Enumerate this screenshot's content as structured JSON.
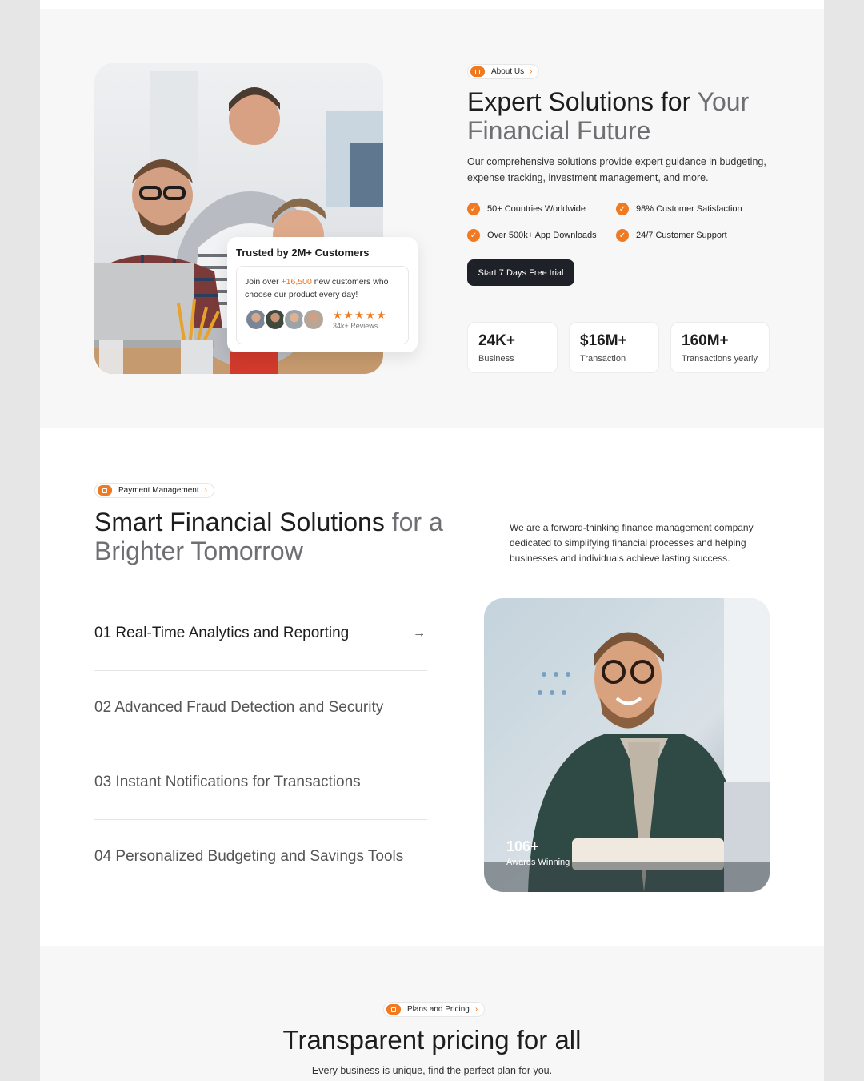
{
  "about": {
    "pill_label": "About Us",
    "heading_main": "Expert Solutions for ",
    "heading_muted": "Your Financial Future",
    "lead": "Our comprehensive solutions provide expert guidance in budgeting, expense tracking, investment management, and more.",
    "features": [
      "50+ Countries Worldwide",
      "98% Customer Satisfaction",
      "Over 500k+ App Downloads",
      "24/7 Customer Support"
    ],
    "cta_label": "Start 7 Days Free trial",
    "stats": [
      {
        "value": "24K+",
        "label": "Business"
      },
      {
        "value": "$16M+",
        "label": "Transaction"
      },
      {
        "value": "160M+",
        "label": "Transactions yearly"
      }
    ]
  },
  "trust": {
    "title": "Trusted by 2M+ Customers",
    "text_before": "Join over ",
    "highlight": "+16,500",
    "text_after": " new customers who choose our product every day!",
    "stars": "★★★★★",
    "reviews": "34k+ Reviews",
    "rating": 5
  },
  "payment": {
    "pill_label": "Payment Management",
    "heading_main": "Smart Financial Solutions ",
    "heading_muted": "for a Brighter Tomorrow",
    "description": "We are a forward-thinking finance management company dedicated to simplifying financial processes and helping businesses and individuals achieve lasting success.",
    "items": [
      "01 Real-Time Analytics and Reporting",
      "02 Advanced Fraud Detection and Security",
      "03 Instant Notifications for Transactions",
      "04 Personalized Budgeting and Savings Tools"
    ],
    "award_value": "106+",
    "award_label": "Awards Winning"
  },
  "pricing": {
    "pill_label": "Plans and Pricing",
    "heading": "Transparent pricing for all",
    "subheading": "Every business is unique, find the perfect plan for you."
  },
  "icons": {
    "pill_icon": "card-icon",
    "chevron": "chevron-right-icon",
    "check": "check-icon",
    "arrow": "arrow-right-icon"
  },
  "colors": {
    "accent": "#ef7a22",
    "dark_button": "#1f2129",
    "section_bg": "#f7f7f7"
  }
}
